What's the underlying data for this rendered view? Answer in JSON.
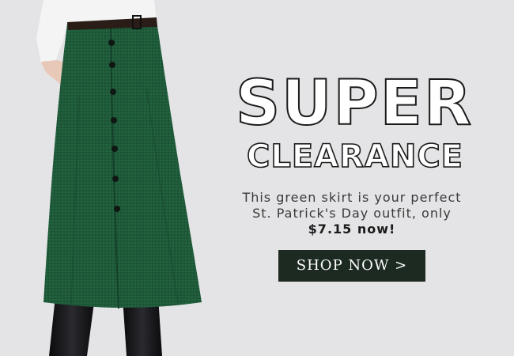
{
  "headline": {
    "line1": "SUPER",
    "line2": "CLEARANCE"
  },
  "description": {
    "line1": "This green skirt is your perfect",
    "line2": "St. Patrick's Day outfit, only",
    "price": "$7.15 now!"
  },
  "cta": {
    "label": "SHOP NOW >"
  },
  "colors": {
    "background": "#e4e4e6",
    "skirt": "#1f5a3a",
    "button": "#1d2a22",
    "headline_outline": "#1a1a1a"
  }
}
